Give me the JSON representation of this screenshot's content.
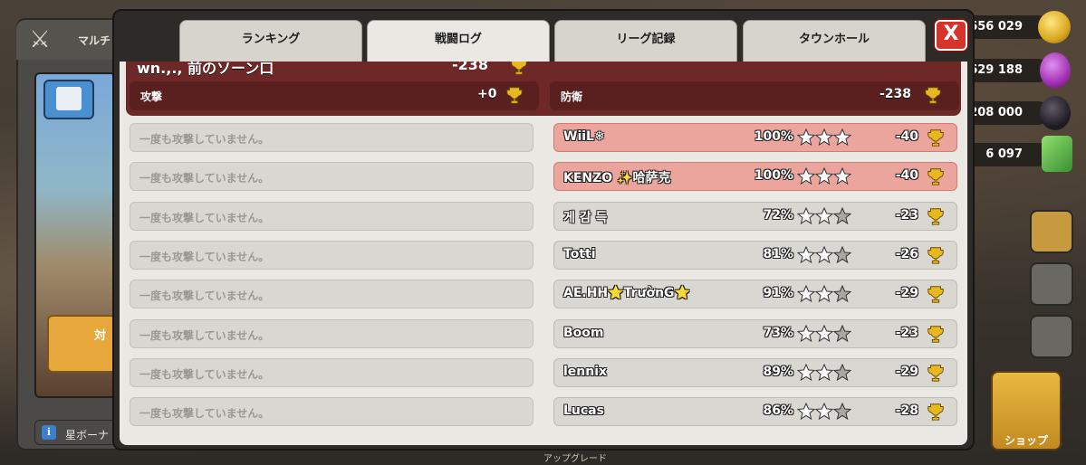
{
  "background": {
    "left_panel_title": "マルチ",
    "left_panel_button": "対",
    "left_panel_info": "星ボーナ",
    "resources": [
      {
        "name": "gold",
        "value": "656 029",
        "color": "#e8c030"
      },
      {
        "name": "elixir",
        "value": "629 188",
        "color": "#b040c0"
      },
      {
        "name": "dark-elixir",
        "value": "208 000",
        "color": "#2a2830"
      },
      {
        "name": "gems",
        "value": "6 097",
        "color": "#58b040"
      }
    ],
    "shop_label": "ショップ",
    "bottom_text": "アップグレード"
  },
  "tabs": [
    {
      "label": "ランキング",
      "active": false
    },
    {
      "label": "戦闘ログ",
      "active": true
    },
    {
      "label": "リーグ記録",
      "active": false
    },
    {
      "label": "タウンホール",
      "active": false
    }
  ],
  "close_label": "X",
  "summary": {
    "cut_title": "wn.,., 前のソーン口",
    "cut_value": "-238",
    "attack_label": "攻撃",
    "attack_value": "+0",
    "defense_label": "防衛",
    "defense_value": "-238"
  },
  "attacks": [
    "一度も攻撃していません。",
    "一度も攻撃していません。",
    "一度も攻撃していません。",
    "一度も攻撃していません。",
    "一度も攻撃していません。",
    "一度も攻撃していません。",
    "一度も攻撃していません。",
    "一度も攻撃していません。"
  ],
  "defenses": [
    {
      "name": "WiiL❄",
      "percent": "100%",
      "stars": 3,
      "trophies": "-40"
    },
    {
      "name": "KENZO ✨哈萨克",
      "percent": "100%",
      "stars": 3,
      "trophies": "-40"
    },
    {
      "name": "게 감 득",
      "percent": "72%",
      "stars": 2,
      "trophies": "-23"
    },
    {
      "name": "Totti",
      "percent": "81%",
      "stars": 2,
      "trophies": "-26"
    },
    {
      "name": "AE.HH⭐TrườnG⭐",
      "percent": "91%",
      "stars": 2,
      "trophies": "-29"
    },
    {
      "name": "Boom",
      "percent": "73%",
      "stars": 2,
      "trophies": "-23"
    },
    {
      "name": "lennix",
      "percent": "89%",
      "stars": 2,
      "trophies": "-29"
    },
    {
      "name": "Lucas",
      "percent": "86%",
      "stars": 2,
      "trophies": "-28"
    }
  ],
  "colors": {
    "star_filled": "#ffffff",
    "star_empty": "#a8a7a2",
    "trophy": "#e8b820",
    "lost_row": "#eba59c",
    "summary_bg": "#6e2828"
  }
}
